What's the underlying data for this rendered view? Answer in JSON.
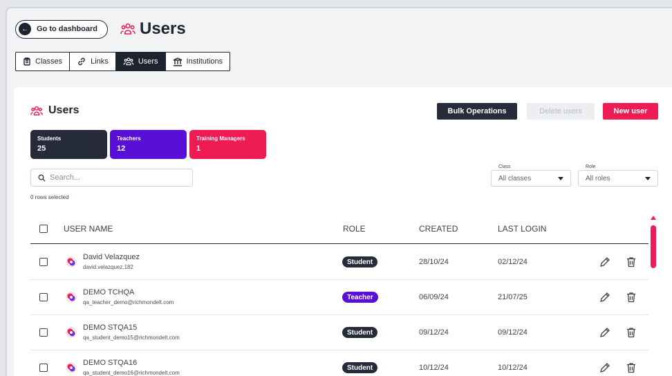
{
  "header": {
    "back_label": "Go to dashboard",
    "title": "Users"
  },
  "tabs": [
    {
      "label": "Classes",
      "icon": "clipboard-icon"
    },
    {
      "label": "Links",
      "icon": "link-icon"
    },
    {
      "label": "Users",
      "icon": "users-icon",
      "active": true
    },
    {
      "label": "Institutions",
      "icon": "institution-icon"
    }
  ],
  "panel": {
    "title": "Users",
    "bulk_label": "Bulk Operations",
    "delete_label": "Delete users",
    "new_label": "New user"
  },
  "cards": [
    {
      "label": "Students",
      "count": "25",
      "color": "#262b3a"
    },
    {
      "label": "Teachers",
      "count": "12",
      "color": "#5a0fd6"
    },
    {
      "label": "Training Managers",
      "count": "1",
      "color": "#ef1b55"
    }
  ],
  "search": {
    "placeholder": "Search..."
  },
  "rows_selected": "0 rows selected",
  "filters": {
    "class_label": "Class",
    "class_value": "All classes",
    "role_label": "Role",
    "role_value": "All roles"
  },
  "table": {
    "headers": {
      "user_name": "USER NAME",
      "role": "ROLE",
      "created": "CREATED",
      "last_login": "LAST LOGIN"
    },
    "rows": [
      {
        "name": "David Velazquez",
        "email": "david.velazquez.182",
        "role": "Student",
        "created": "28/10/24",
        "last_login": "02/12/24"
      },
      {
        "name": "DEMO TCHQA",
        "email": "qa_teacher_demo@richmondelt.com",
        "role": "Teacher",
        "created": "06/09/24",
        "last_login": "21/07/25"
      },
      {
        "name": "DEMO STQA15",
        "email": "qa_student_demo15@richmondelt.com",
        "role": "Student",
        "created": "09/12/24",
        "last_login": "09/12/24"
      },
      {
        "name": "DEMO STQA16",
        "email": "qa_student_demo16@richmondelt.com",
        "role": "Student",
        "created": "10/12/24",
        "last_login": "10/12/24"
      }
    ]
  },
  "colors": {
    "accent": "#ef1b55",
    "dark": "#262b3a",
    "purple": "#5a0fd6"
  }
}
